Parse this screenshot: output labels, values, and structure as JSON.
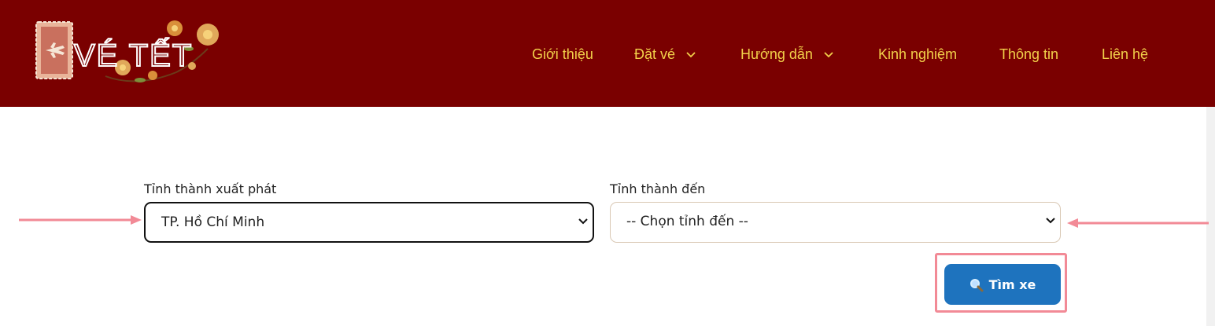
{
  "header": {
    "logo_text": "VÉ TẾT",
    "nav": [
      {
        "label": "Giới thiệu",
        "has_dropdown": false
      },
      {
        "label": "Đặt vé",
        "has_dropdown": true
      },
      {
        "label": "Hướng dẫn",
        "has_dropdown": true
      },
      {
        "label": "Kinh nghiệm",
        "has_dropdown": false
      },
      {
        "label": "Thông tin",
        "has_dropdown": false
      },
      {
        "label": "Liên hệ",
        "has_dropdown": false
      }
    ]
  },
  "form": {
    "from_label": "Tỉnh thành xuất phát",
    "from_value": "TP. Hồ Chí Minh",
    "to_label": "Tỉnh thành đến",
    "to_value": "-- Chọn tỉnh đến --",
    "search_button": "Tìm xe"
  },
  "colors": {
    "header_bg": "#7a0000",
    "nav_text": "#f2d04a",
    "button_bg": "#1e73be",
    "annotation": "#f28a96"
  },
  "icons": {
    "search": "magnifier-icon",
    "dropdown": "chevron-down-icon",
    "logo": "plane-ticket-icon"
  }
}
